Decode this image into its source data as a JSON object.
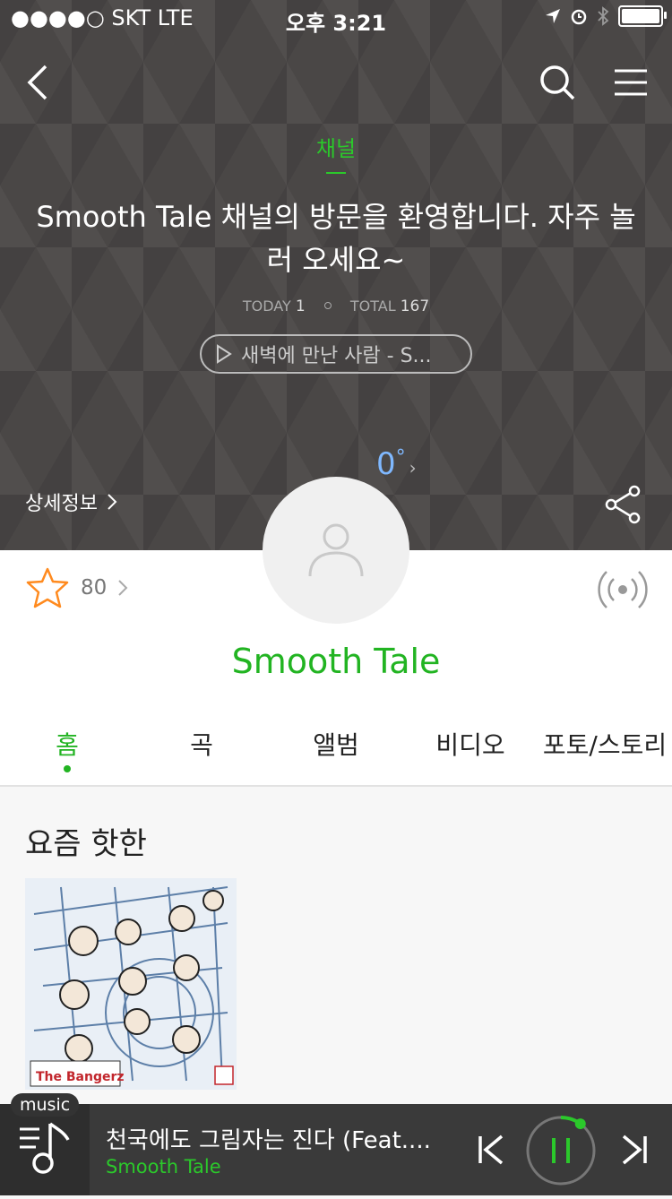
{
  "status_bar": {
    "carrier": "●●●●○ SKT   LTE",
    "time": "오후 3:21"
  },
  "header": {
    "channel_label": "채널",
    "greeting": "Smooth Tale 채널의 방문을 환영합니다. 자주 놀러 오세요~",
    "today_label": "TODAY",
    "today_count": "1",
    "total_label": "TOTAL",
    "total_count": "167",
    "now_playing_pill": "새벽에 만난 사람 - S...",
    "temperature": "0",
    "temperature_unit": "°",
    "detail_info": "상세정보"
  },
  "profile": {
    "fan_count": "80",
    "artist_name": "Smooth Tale"
  },
  "tabs": [
    {
      "label": "홈",
      "active": true
    },
    {
      "label": "곡"
    },
    {
      "label": "앨범"
    },
    {
      "label": "비디오"
    },
    {
      "label": "포토/스토리"
    }
  ],
  "section": {
    "title": "요즘 핫한",
    "album_caption": "The Bangerz"
  },
  "player": {
    "badge": "music",
    "track_title": "천국에도 그림자는 진다 (Feat....",
    "artist": "Smooth Tale",
    "progress": 0.1
  },
  "colors": {
    "accent": "#22b422",
    "header_bg": "#4a4746",
    "temperature": "#7fb8ff",
    "star": "#ff8a1e"
  }
}
